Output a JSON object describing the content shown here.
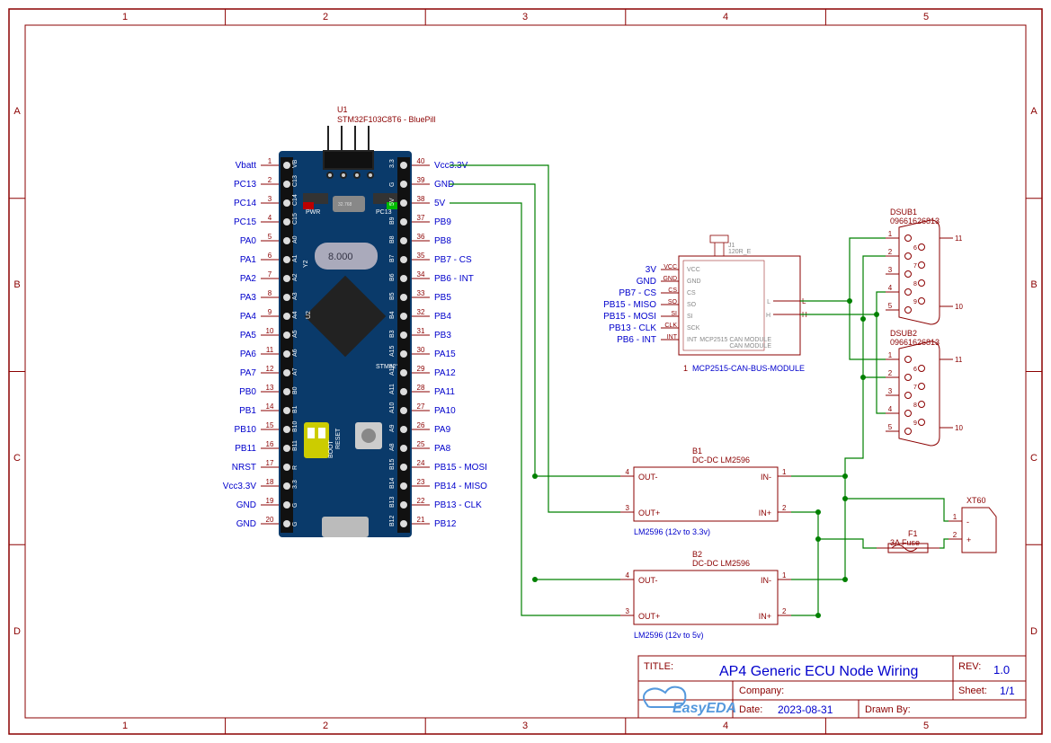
{
  "frame": {
    "cols": [
      "1",
      "2",
      "3",
      "4",
      "5"
    ],
    "rows": [
      "A",
      "B",
      "C",
      "D"
    ]
  },
  "u1": {
    "ref": "U1",
    "value": "STM32F103C8T6 - BluePill",
    "left_pins": [
      {
        "n": "1",
        "net": "Vbatt"
      },
      {
        "n": "2",
        "net": "PC13"
      },
      {
        "n": "3",
        "net": "PC14"
      },
      {
        "n": "4",
        "net": "PC15"
      },
      {
        "n": "5",
        "net": "PA0"
      },
      {
        "n": "6",
        "net": "PA1"
      },
      {
        "n": "7",
        "net": "PA2"
      },
      {
        "n": "8",
        "net": "PA3"
      },
      {
        "n": "9",
        "net": "PA4"
      },
      {
        "n": "10",
        "net": "PA5"
      },
      {
        "n": "11",
        "net": "PA6"
      },
      {
        "n": "12",
        "net": "PA7"
      },
      {
        "n": "13",
        "net": "PB0"
      },
      {
        "n": "14",
        "net": "PB1"
      },
      {
        "n": "15",
        "net": "PB10"
      },
      {
        "n": "16",
        "net": "PB11"
      },
      {
        "n": "17",
        "net": "NRST"
      },
      {
        "n": "18",
        "net": "Vcc3.3V"
      },
      {
        "n": "19",
        "net": "GND"
      },
      {
        "n": "20",
        "net": "GND"
      }
    ],
    "right_pins": [
      {
        "n": "40",
        "net": "Vcc3.3V"
      },
      {
        "n": "39",
        "net": "GND"
      },
      {
        "n": "38",
        "net": "5V"
      },
      {
        "n": "37",
        "net": "PB9"
      },
      {
        "n": "36",
        "net": "PB8"
      },
      {
        "n": "35",
        "net": "PB7 - CS"
      },
      {
        "n": "34",
        "net": "PB6 - INT"
      },
      {
        "n": "33",
        "net": "PB5"
      },
      {
        "n": "32",
        "net": "PB4"
      },
      {
        "n": "31",
        "net": "PB3"
      },
      {
        "n": "30",
        "net": "PA15"
      },
      {
        "n": "29",
        "net": "PA12"
      },
      {
        "n": "28",
        "net": "PA11"
      },
      {
        "n": "27",
        "net": "PA10"
      },
      {
        "n": "26",
        "net": "PA9"
      },
      {
        "n": "25",
        "net": "PA8"
      },
      {
        "n": "24",
        "net": "PB15 - MOSI"
      },
      {
        "n": "23",
        "net": "PB14 - MISO"
      },
      {
        "n": "22",
        "net": "PB13 - CLK"
      },
      {
        "n": "21",
        "net": "PB12"
      }
    ],
    "silk_left": [
      "VB",
      "C13",
      "C14",
      "C15",
      "A0",
      "A1",
      "A2",
      "A3",
      "A4",
      "A5",
      "A6",
      "A7",
      "B0",
      "B1",
      "B10",
      "B11",
      "R",
      "3.3",
      "G",
      "G"
    ],
    "silk_right": [
      "3.3",
      "G",
      "5V",
      "B9",
      "B8",
      "B7",
      "B6",
      "B5",
      "B4",
      "B3",
      "A15",
      "A12",
      "A11",
      "A10",
      "A9",
      "A8",
      "B15",
      "B14",
      "B13",
      "B12"
    ],
    "pwr": "PWR",
    "pc13": "PC13",
    "reset": "RESET",
    "boot": "BOOT",
    "stm32": "STM32°",
    "y2": "Y2",
    "u2": "U2",
    "xtal": "8.000"
  },
  "mcp": {
    "ref": "1",
    "name": "MCP2515-CAN-BUS-MODULE",
    "chip": "MCP2515 CAN MODULE",
    "left": [
      {
        "net": "3V",
        "pin": "VCC",
        "silk": "VCC"
      },
      {
        "net": "GND",
        "pin": "GND",
        "silk": "GND"
      },
      {
        "net": "PB7 - CS",
        "pin": "CS",
        "silk": "CS"
      },
      {
        "net": "PB15 - MISO",
        "pin": "SO",
        "silk": "SO"
      },
      {
        "net": "PB15 - MOSI",
        "pin": "SI",
        "silk": "SI"
      },
      {
        "net": "PB13 - CLK",
        "pin": "CLK",
        "silk": "SCK"
      },
      {
        "net": "PB6 - INT",
        "pin": "INT",
        "silk": "INT"
      }
    ],
    "right": [
      {
        "pin": "L",
        "silk": "L"
      },
      {
        "pin": "H",
        "silk": "H"
      }
    ],
    "j1": [
      "J1",
      "120R_E"
    ]
  },
  "dsub1": {
    "ref": "DSUB1",
    "pn": "09661626813",
    "pins_l": [
      "1",
      "2",
      "3",
      "4",
      "5"
    ],
    "pins_r": [
      "6",
      "7",
      "8",
      "9"
    ],
    "mnt": [
      "10",
      "11"
    ]
  },
  "dsub2": {
    "ref": "DSUB2",
    "pn": "09661626813",
    "pins_l": [
      "1",
      "2",
      "3",
      "4",
      "5"
    ],
    "pins_r": [
      "6",
      "7",
      "8",
      "9"
    ],
    "mnt": [
      "10",
      "11"
    ]
  },
  "b1": {
    "ref": "B1",
    "val": "DC-DC LM2596",
    "desc": "LM2596 (12v to 3.3v)",
    "pins": {
      "op": "OUT+",
      "om": "OUT-",
      "ip": "IN+",
      "im": "IN-",
      "n": [
        "4",
        "3",
        "1",
        "2"
      ]
    }
  },
  "b2": {
    "ref": "B2",
    "val": "DC-DC LM2596",
    "desc": "LM2596 (12v to 5v)",
    "pins": {
      "op": "OUT+",
      "om": "OUT-",
      "ip": "IN+",
      "im": "IN-",
      "n": [
        "4",
        "3",
        "1",
        "2"
      ]
    }
  },
  "f1": {
    "ref": "F1",
    "val": "3A Fuse"
  },
  "xt60": {
    "ref": "XT60",
    "p1": "1",
    "p2": "2",
    "minus": "-",
    "plus": "+"
  },
  "title_block": {
    "title_lbl": "TITLE:",
    "title": "AP4 Generic ECU Node Wiring",
    "rev_lbl": "REV:",
    "rev": "1.0",
    "company_lbl": "Company:",
    "sheet_lbl": "Sheet:",
    "sheet": "1/1",
    "date_lbl": "Date:",
    "date": "2023-08-31",
    "drawn_lbl": "Drawn By:",
    "logo": "EasyEDA"
  }
}
